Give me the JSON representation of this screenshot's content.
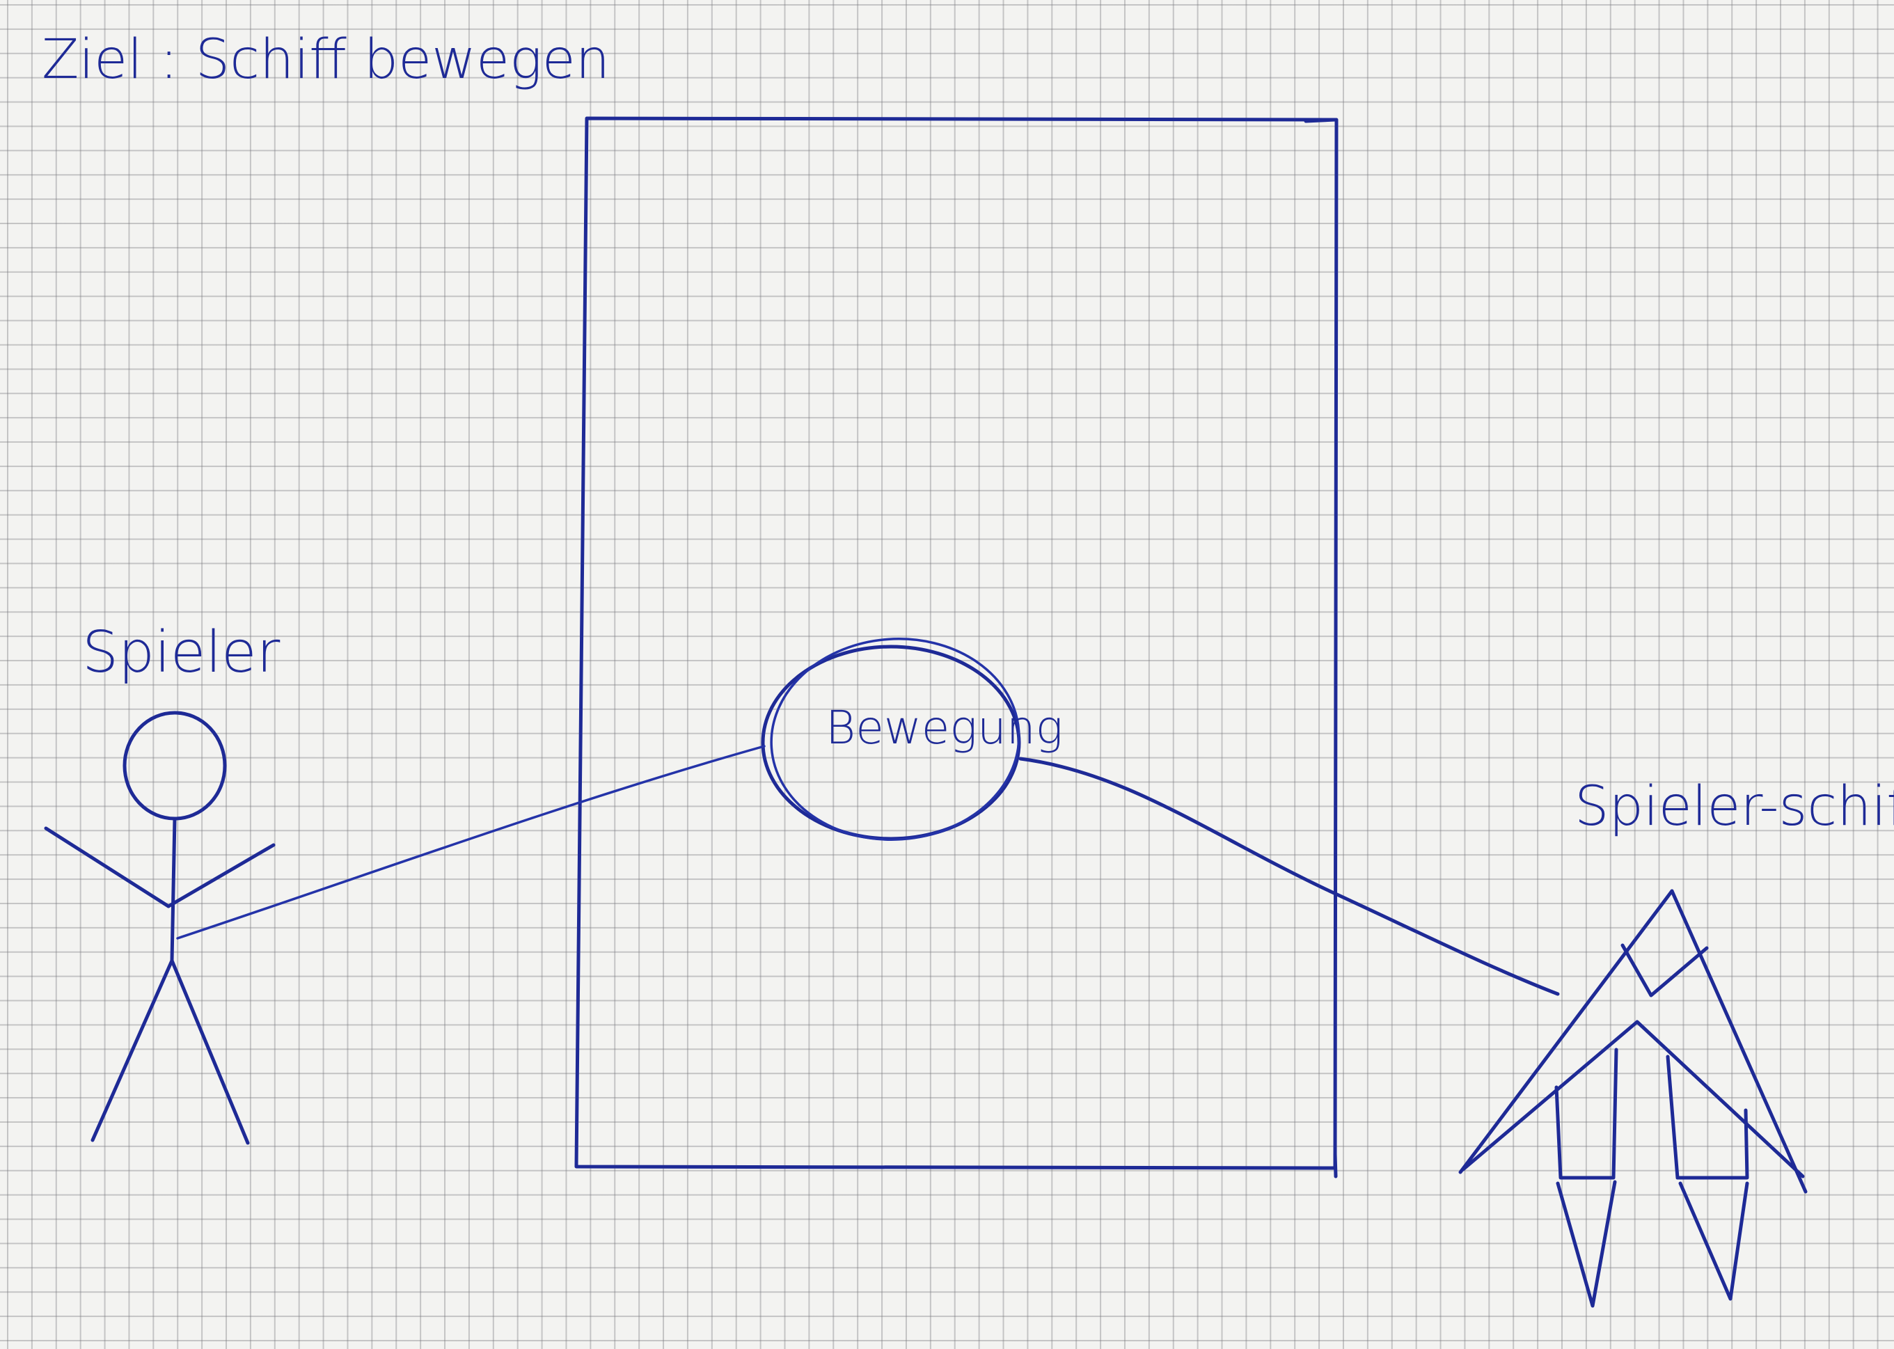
{
  "title": "Ziel : Schiff bewegen",
  "actor": {
    "label": "Spieler"
  },
  "use_case": {
    "label": "Bewegung"
  },
  "ship": {
    "label": "Spieler-schiff"
  },
  "colors": {
    "ink": "#1e2a96",
    "paper": "#f3f3f1",
    "grid": "#8c8c90"
  }
}
